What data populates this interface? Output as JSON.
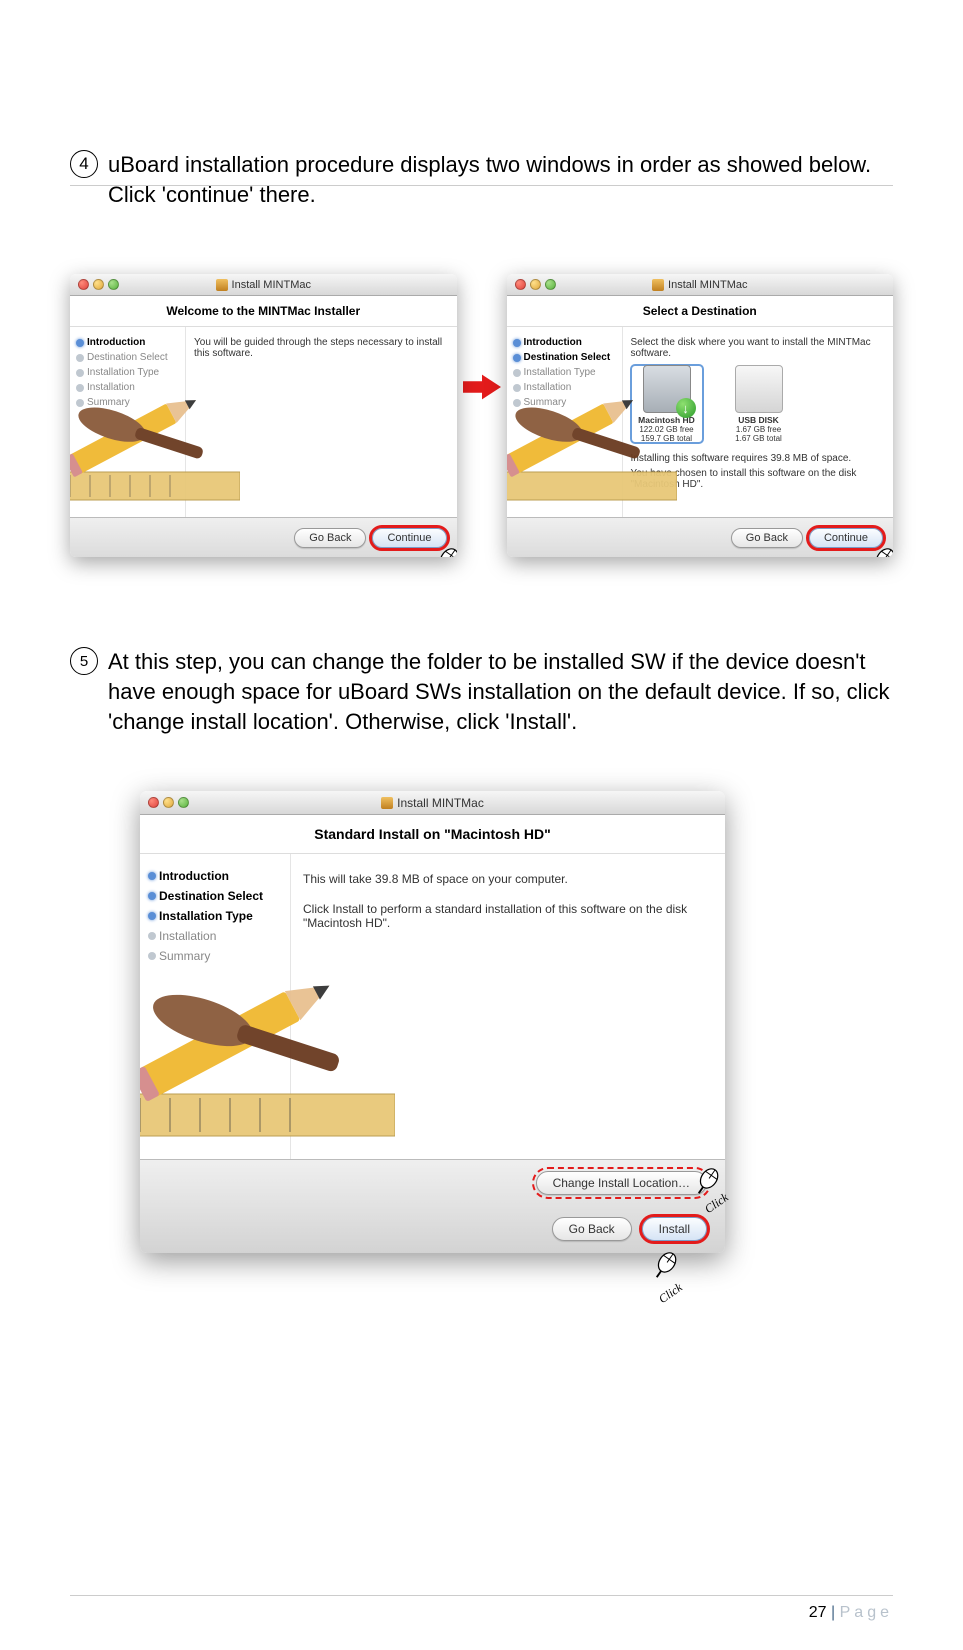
{
  "steps": {
    "s4": {
      "num": "4",
      "text": "uBoard installation procedure displays two windows in order as showed below. Click 'continue' there."
    },
    "s5": {
      "num": "5",
      "text": "At this step, you can change the folder to be installed SW if the device doesn't have enough space for uBoard SWs installation on the default device. If so, click 'change install location'. Otherwise, click 'Install'."
    }
  },
  "click_label": "Click",
  "window1": {
    "title": "Install MINTMac",
    "subheader": "Welcome to the MINTMac Installer",
    "sidebar": [
      "Introduction",
      "Destination Select",
      "Installation Type",
      "Installation",
      "Summary"
    ],
    "active_idx": 0,
    "content": "You will be guided through the steps necessary to install this software.",
    "btn_back": "Go Back",
    "btn_continue": "Continue"
  },
  "window2": {
    "title": "Install MINTMac",
    "subheader": "Select a Destination",
    "sidebar": [
      "Introduction",
      "Destination Select",
      "Installation Type",
      "Installation",
      "Summary"
    ],
    "active_idx": 1,
    "intro": "Select the disk where you want to install the MINTMac software.",
    "disk1_name": "Macintosh HD",
    "disk1_free": "122.02 GB free",
    "disk1_total": "159.7 GB total",
    "disk2_name": "USB DISK",
    "disk2_free": "1.67 GB free",
    "disk2_total": "1.67 GB total",
    "space_req": "Installing this software requires 39.8 MB of space.",
    "chosen": "You have chosen to install this software on the disk \"Macintosh HD\".",
    "btn_back": "Go Back",
    "btn_continue": "Continue"
  },
  "window3": {
    "title": "Install MINTMac",
    "subheader": "Standard Install on \"Macintosh HD\"",
    "sidebar": [
      "Introduction",
      "Destination Select",
      "Installation Type",
      "Installation",
      "Summary"
    ],
    "active_idx": 2,
    "line1": "This will take 39.8 MB of space on your computer.",
    "line2": "Click Install to perform a standard installation of this software on the disk \"Macintosh HD\".",
    "btn_change": "Change Install Location…",
    "btn_back": "Go Back",
    "btn_install": "Install"
  },
  "footer": {
    "num": "27",
    "sep": " | ",
    "word": "Page"
  }
}
